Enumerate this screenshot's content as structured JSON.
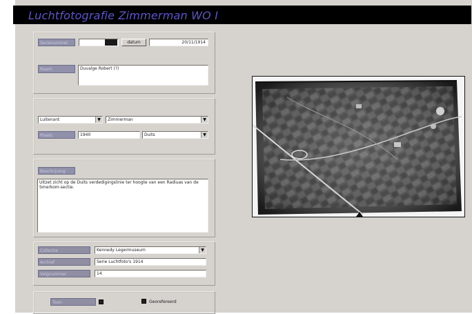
{
  "window": {
    "title": "Luchtfotografie Zimmerman WO I"
  },
  "header": {
    "label_1": "Serienummer",
    "number_value": "",
    "date_label": "datum",
    "date_value": "20/11/1914",
    "name_label": "Naam",
    "name_value": "Duvalge Robert (?)"
  },
  "group": {
    "rank_value": "Luitenant",
    "unit_value": "Zimmerman",
    "label_2": "Plaats",
    "year_value": "1940",
    "region_value": "Duits"
  },
  "description": {
    "label": "Beschrijving",
    "text": "Uitzet zicht op de Duits verdedigingslinie ter hoogte van een Radiuas van de Smerkom-sectie."
  },
  "collection": {
    "label_a": "Collectie",
    "value_a": "Kennedy Legermuseum",
    "label_b": "Archief",
    "value_b": "Serie Luchtfoto's 1914",
    "label_c": "Volgnummer",
    "value_c": "14"
  },
  "footer": {
    "button_label": "Toon",
    "check_label": "Georefereerd"
  },
  "photo": {
    "caption": ""
  }
}
